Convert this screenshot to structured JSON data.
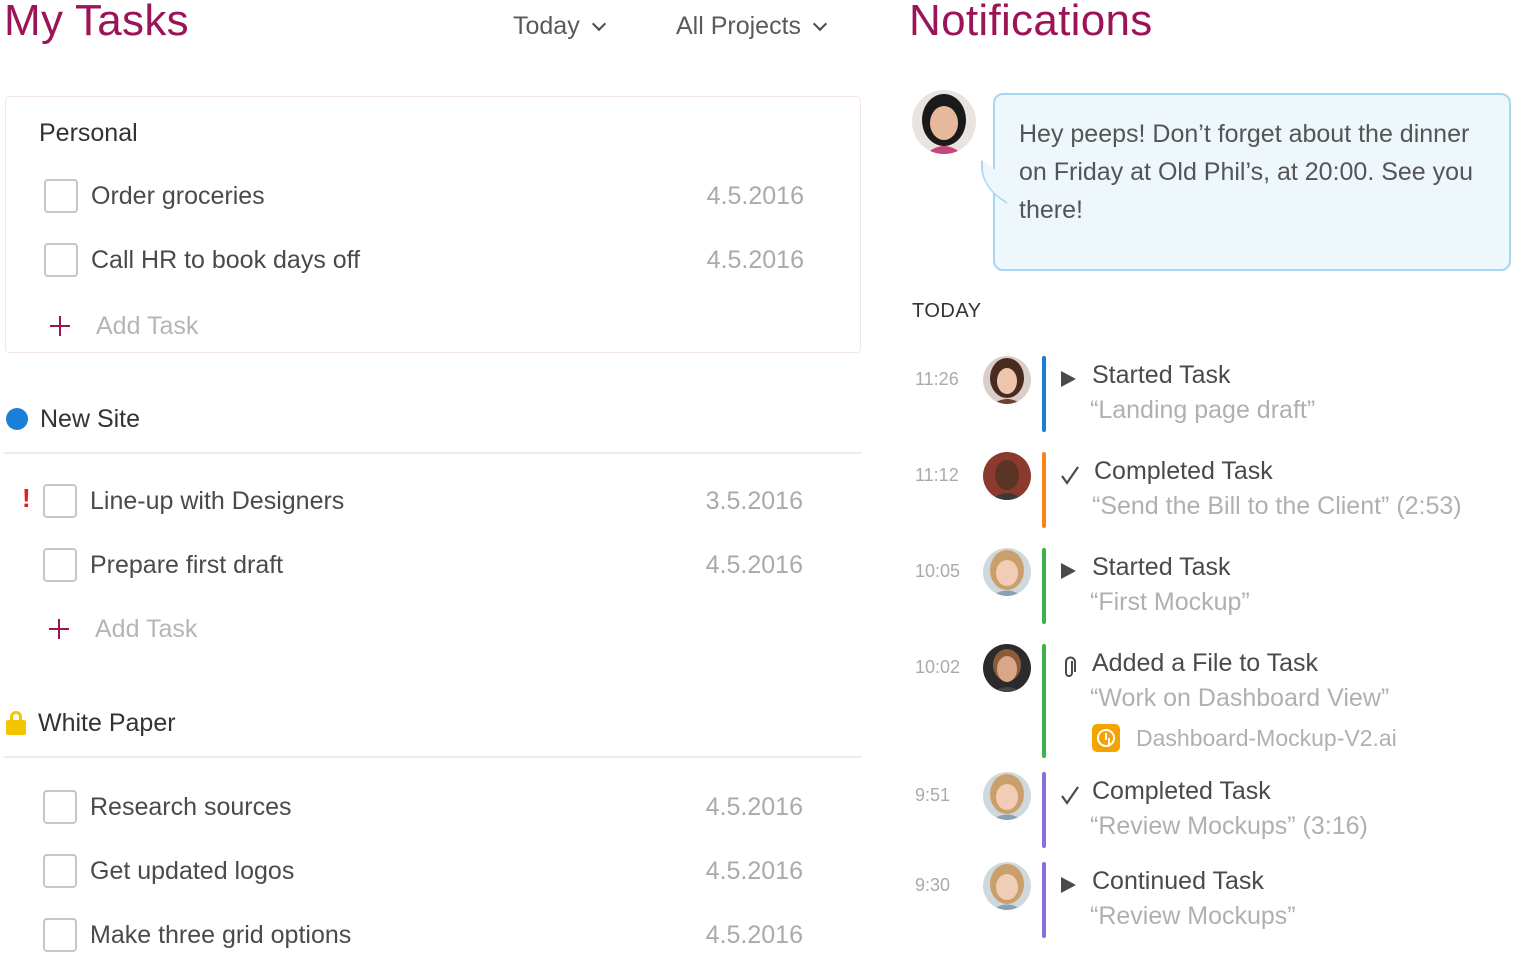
{
  "tasks": {
    "title": "My Tasks",
    "filter_date": "Today",
    "filter_project": "All Projects",
    "add_label": "Add Task",
    "personal": {
      "title": "Personal",
      "items": [
        {
          "label": "Order groceries",
          "date": "4.5.2016"
        },
        {
          "label": "Call HR to book days off",
          "date": "4.5.2016"
        }
      ]
    },
    "new_site": {
      "title": "New Site",
      "color": "#1a7fd6",
      "items": [
        {
          "label": "Line-up with Designers",
          "date": "3.5.2016",
          "priority": "!"
        },
        {
          "label": "Prepare first draft",
          "date": "4.5.2016"
        }
      ]
    },
    "white_paper": {
      "title": "White Paper",
      "color": "#f5c400",
      "icon": "lock-icon",
      "items": [
        {
          "label": "Research sources",
          "date": "4.5.2016"
        },
        {
          "label": "Get updated logos",
          "date": "4.5.2016"
        },
        {
          "label": "Make three grid options",
          "date": "4.5.2016"
        }
      ]
    }
  },
  "notifications": {
    "title": "Notifications",
    "message": "Hey peeps! Don’t forget about the dinner on Friday at Old Phil’s, at 20:00. See you there!",
    "today_label": "TODAY",
    "activity": [
      {
        "time": "11:26",
        "icon": "play-icon",
        "title": "Started Task",
        "subject": "“Landing page draft”",
        "color": "#1a7fd6"
      },
      {
        "time": "11:12",
        "icon": "check-icon",
        "title": "Completed Task",
        "subject": "“Send the Bill to the Client” (2:53)",
        "color": "#f5861f"
      },
      {
        "time": "10:05",
        "icon": "play-icon",
        "title": "Started Task",
        "subject": "“First Mockup”",
        "color": "#3cb44a"
      },
      {
        "time": "10:02",
        "icon": "paperclip-icon",
        "title": "Added a File to Task",
        "subject": "“Work on Dashboard View”",
        "file": "Dashboard-Mockup-V2.ai",
        "color": "#3cb44a"
      },
      {
        "time": "9:51",
        "icon": "check-icon",
        "title": "Completed Task",
        "subject": "“Review Mockups” (3:16)",
        "color": "#8a6fe0"
      },
      {
        "time": "9:30",
        "icon": "play-icon",
        "title": "Continued Task",
        "subject": "“Review Mockups”",
        "color": "#8a6fe0"
      }
    ]
  }
}
